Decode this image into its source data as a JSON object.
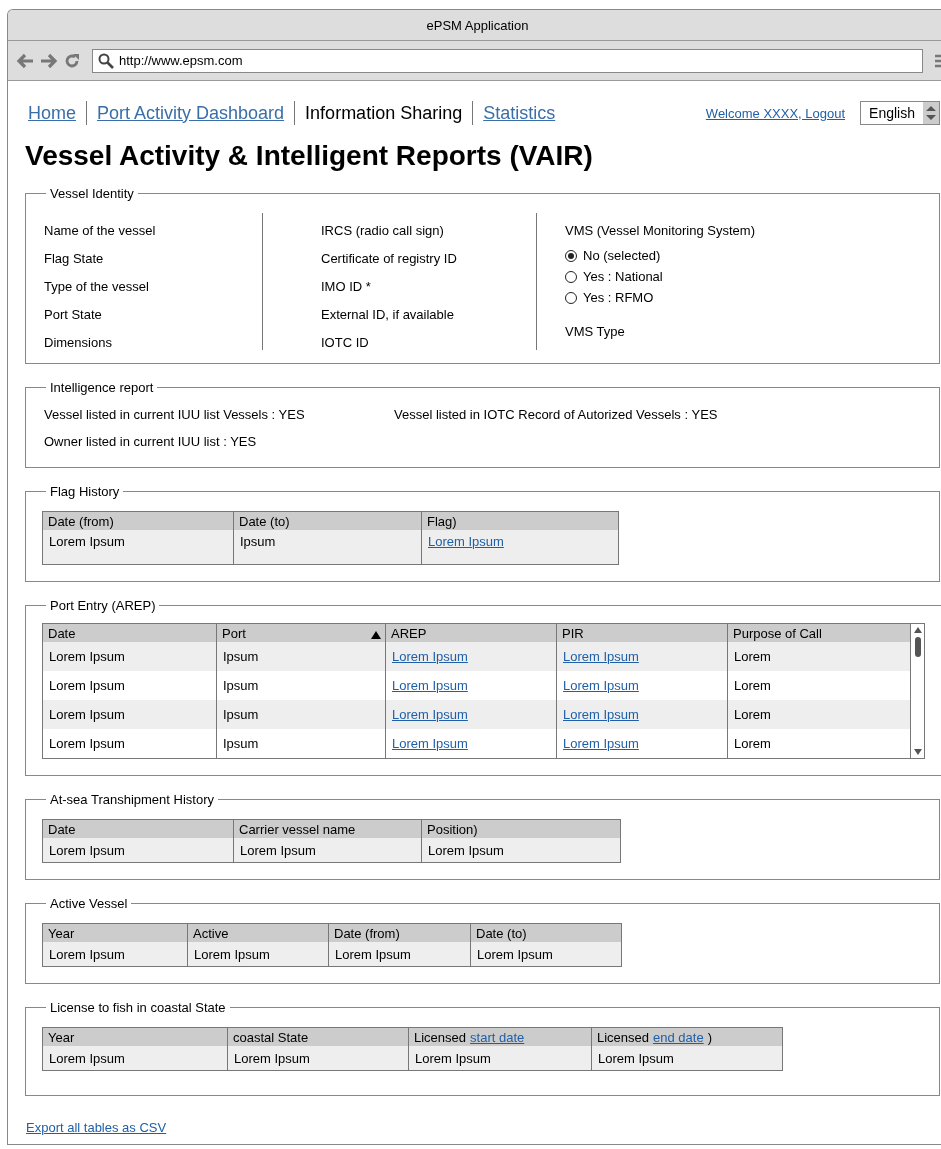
{
  "window": {
    "title": "ePSM Application"
  },
  "browser": {
    "url": "http://www.epsm.com"
  },
  "nav": {
    "items": [
      {
        "label": "Home",
        "selected": false
      },
      {
        "label": "Port Activity Dashboard",
        "selected": false
      },
      {
        "label": "Information Sharing",
        "selected": true
      },
      {
        "label": "Statistics",
        "selected": false
      }
    ],
    "user_link": "Welcome XXXX, Logout",
    "language": "English"
  },
  "page_title": "Vessel Activity & Intelligent Reports (VAIR)",
  "vessel_identity": {
    "title": "Vessel Identity",
    "column_1": [
      "Name of the vessel",
      "Flag State",
      "Type of the vessel",
      "Port State",
      "Dimensions"
    ],
    "column_2": [
      "IRCS (radio call sign)",
      "Certificate of registry ID",
      "IMO ID *",
      "External ID, if available",
      "IOTC ID"
    ],
    "vms": {
      "label": "VMS (Vessel Monitoring System)",
      "options": [
        {
          "label": "No (selected)",
          "selected": true
        },
        {
          "label": "Yes : National",
          "selected": false
        },
        {
          "label": "Yes : RFMO",
          "selected": false
        }
      ],
      "type_label": "VMS Type"
    }
  },
  "intelligence_report": {
    "title": "Intelligence report",
    "lines": [
      [
        "Vessel listed in current IUU list Vessels : YES",
        "Vessel listed in IOTC Record of Autorized Vessels : YES"
      ],
      [
        "Owner listed in current IUU list : YES"
      ]
    ]
  },
  "tables": [
    {
      "title": "Flag History",
      "columns": [
        {
          "label": "Date (from)"
        },
        {
          "label": "Date (to)"
        },
        {
          "label": "Flag)",
          "kind": "link"
        }
      ],
      "rows": [
        [
          "Lorem Ipsum",
          "Ipsum",
          "Lorem Ipsum"
        ]
      ]
    },
    {
      "title": "Port Entry (AREP)",
      "columns": [
        {
          "label": "Date"
        },
        {
          "label": "Port",
          "sorted": true
        },
        {
          "label": "AREP",
          "kind": "link"
        },
        {
          "label": "PIR",
          "kind": "link"
        },
        {
          "label": "Purpose of Call"
        }
      ],
      "rows": [
        [
          "Lorem Ipsum",
          "Ipsum",
          "Lorem Ipsum",
          "Lorem Ipsum",
          "Lorem"
        ],
        [
          "Lorem Ipsum",
          "Ipsum",
          "Lorem Ipsum",
          "Lorem Ipsum",
          "Lorem"
        ],
        [
          "Lorem Ipsum",
          "Ipsum",
          "Lorem Ipsum",
          "Lorem Ipsum",
          "Lorem"
        ],
        [
          "Lorem Ipsum",
          "Ipsum",
          "Lorem Ipsum",
          "Lorem Ipsum",
          "Lorem"
        ]
      ]
    },
    {
      "title": "At-sea Transhipment History",
      "columns": [
        {
          "label": "Date"
        },
        {
          "label": "Carrier vessel name"
        },
        {
          "label": "Position)"
        }
      ],
      "rows": [
        [
          "Lorem Ipsum",
          "Lorem Ipsum",
          "Lorem Ipsum"
        ]
      ]
    },
    {
      "title": "Active Vessel",
      "columns": [
        {
          "label": "Year"
        },
        {
          "label": "Active"
        },
        {
          "label": "Date (from)"
        },
        {
          "label": "Date (to)"
        }
      ],
      "rows": [
        [
          "Lorem Ipsum",
          "Lorem Ipsum",
          "Lorem Ipsum",
          "Lorem Ipsum"
        ]
      ]
    },
    {
      "title": "License to fish in coastal State",
      "columns": [
        {
          "label": "Year"
        },
        {
          "label": "coastal State"
        },
        {
          "label": "Licensed",
          "link": "start date"
        },
        {
          "label": "Licensed",
          "link": "end date",
          "suffix": ")"
        }
      ],
      "rows": [
        [
          "Lorem Ipsum",
          "Lorem Ipsum",
          "Lorem Ipsum",
          "Lorem Ipsum"
        ]
      ]
    }
  ],
  "export_link": "Export all tables as CSV"
}
